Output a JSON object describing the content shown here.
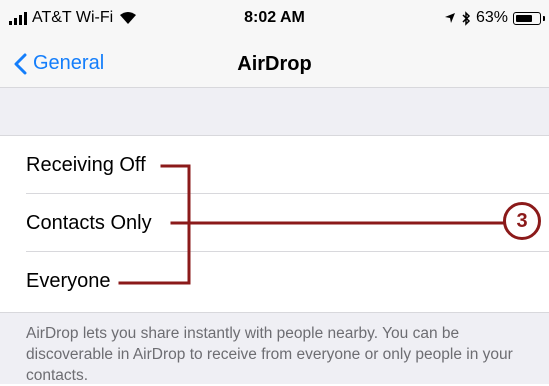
{
  "status_bar": {
    "carrier": "AT&T Wi-Fi",
    "time": "8:02 AM",
    "battery": "63%",
    "battery_level": 0.63,
    "icons": [
      "signal-bars-icon",
      "wifi-icon",
      "location-arrow-icon",
      "bluetooth-icon",
      "battery-icon"
    ]
  },
  "nav": {
    "back_label": "General",
    "title": "AirDrop"
  },
  "options": [
    {
      "label": "Receiving Off",
      "selected": false
    },
    {
      "label": "Contacts Only",
      "selected": true
    },
    {
      "label": "Everyone",
      "selected": false
    }
  ],
  "footer": {
    "text": "AirDrop lets you share instantly with people nearby. You can be discoverable in AirDrop to receive from everyone or only people in your contacts."
  },
  "callout": {
    "number": "3",
    "color": "#8b1a1a"
  },
  "colors": {
    "accent": "#147efb",
    "grouped_bg": "#efeff4",
    "separator": "#d8d8dc",
    "footer_text": "#6d6d72"
  }
}
